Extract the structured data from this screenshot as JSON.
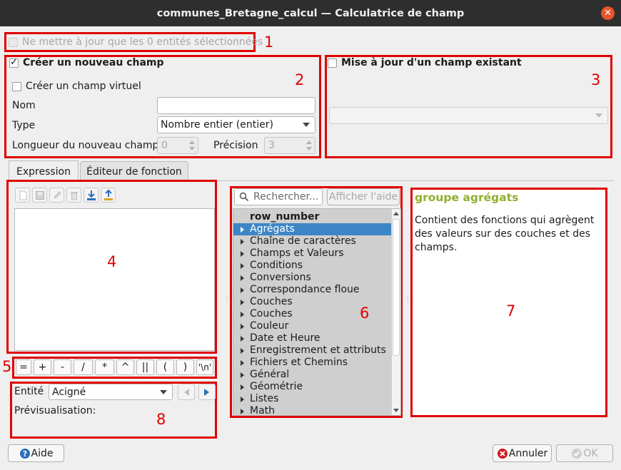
{
  "window": {
    "title": "communes_Bretagne_calcul — Calculatrice de champ"
  },
  "top_option": {
    "label": "Ne mettre à jour que les 0 entités sélectionnées",
    "checked": false,
    "enabled": false
  },
  "new_field": {
    "title": "Créer un nouveau champ",
    "checked": true,
    "virtual_label": "Créer un champ virtuel",
    "name_label": "Nom",
    "name_value": "",
    "type_label": "Type",
    "type_value": "Nombre entier (entier)",
    "length_label": "Longueur du nouveau champ",
    "length_value": "0",
    "precision_label": "Précision",
    "precision_value": "3"
  },
  "update_field": {
    "title": "Mise à jour d'un champ existant",
    "checked": false,
    "selected_value": ""
  },
  "tabs": [
    {
      "label": "Expression",
      "active": true
    },
    {
      "label": "Éditeur de fonction",
      "active": false
    }
  ],
  "expression": {
    "text": ""
  },
  "operators": [
    "=",
    "+",
    "-",
    "/",
    "*",
    "^",
    "||",
    "(",
    ")",
    "'\\n'"
  ],
  "functions": {
    "search_placeholder": "Rechercher...",
    "help_button": "Afficher l'aide",
    "items": [
      {
        "label": "row_number",
        "bold": true,
        "expandable": false,
        "selected": false
      },
      {
        "label": "Agrégats",
        "bold": false,
        "expandable": true,
        "selected": true
      },
      {
        "label": "Chaîne de caractères",
        "bold": false,
        "expandable": true,
        "selected": false
      },
      {
        "label": "Champs et Valeurs",
        "bold": false,
        "expandable": true,
        "selected": false
      },
      {
        "label": "Conditions",
        "bold": false,
        "expandable": true,
        "selected": false
      },
      {
        "label": "Conversions",
        "bold": false,
        "expandable": true,
        "selected": false
      },
      {
        "label": "Correspondance floue",
        "bold": false,
        "expandable": true,
        "selected": false
      },
      {
        "label": "Couches",
        "bold": false,
        "expandable": true,
        "selected": false
      },
      {
        "label": "Couches",
        "bold": false,
        "expandable": true,
        "selected": false
      },
      {
        "label": "Couleur",
        "bold": false,
        "expandable": true,
        "selected": false
      },
      {
        "label": "Date et Heure",
        "bold": false,
        "expandable": true,
        "selected": false
      },
      {
        "label": "Enregistrement et attributs",
        "bold": false,
        "expandable": true,
        "selected": false
      },
      {
        "label": "Fichiers et Chemins",
        "bold": false,
        "expandable": true,
        "selected": false
      },
      {
        "label": "Général",
        "bold": false,
        "expandable": true,
        "selected": false
      },
      {
        "label": "Géométrie",
        "bold": false,
        "expandable": true,
        "selected": false
      },
      {
        "label": "Listes",
        "bold": false,
        "expandable": true,
        "selected": false
      },
      {
        "label": "Math",
        "bold": false,
        "expandable": true,
        "selected": false
      }
    ]
  },
  "help_panel": {
    "title": "groupe agrégats",
    "body": "Contient des fonctions qui agrègent des valeurs sur des couches et des champs."
  },
  "preview": {
    "entity_label": "Entité",
    "entity_value": "Acigné",
    "preview_label": "Prévisualisation:"
  },
  "buttons": {
    "help": "Aide",
    "cancel": "Annuler",
    "ok": "OK"
  },
  "annotations": [
    "1",
    "2",
    "3",
    "4",
    "5",
    "6",
    "7",
    "8"
  ],
  "colors": {
    "annotation": "#e00000",
    "selection": "#3d86c6",
    "help_title": "#8fb02c",
    "titlebar": "#2e2e2e",
    "close": "#e9542c"
  }
}
